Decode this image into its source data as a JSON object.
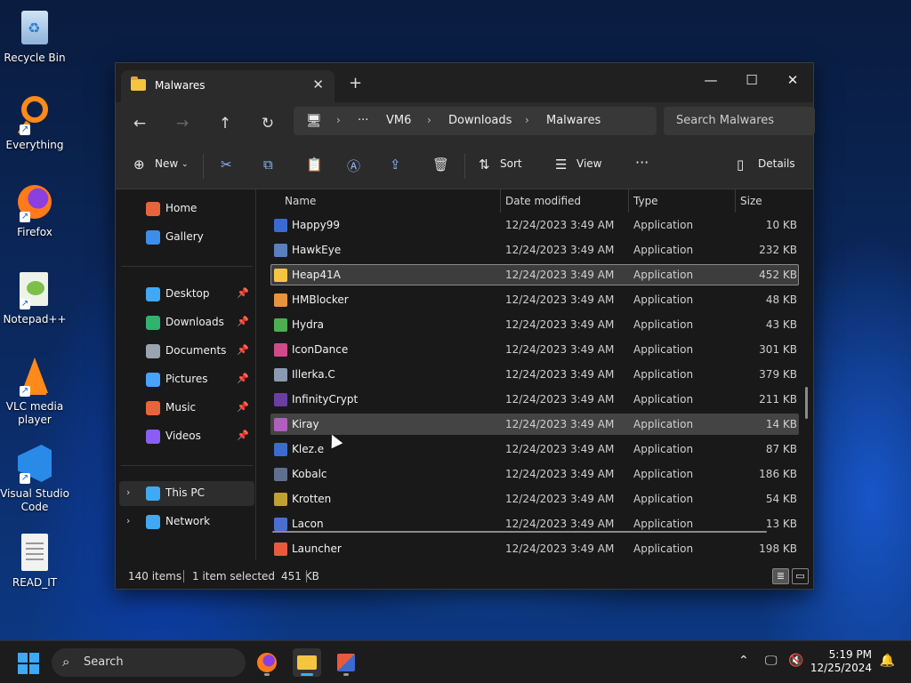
{
  "desktop": {
    "icons": [
      {
        "label": "Recycle Bin",
        "icon": "recycle-bin-icon"
      },
      {
        "label": "Everything",
        "icon": "everything-search-icon"
      },
      {
        "label": "Firefox",
        "icon": "firefox-icon"
      },
      {
        "label": "Notepad++",
        "icon": "notepad-plus-plus-icon"
      },
      {
        "label": "VLC media player",
        "icon": "vlc-icon"
      },
      {
        "label": "Visual Studio Code",
        "icon": "vscode-icon"
      },
      {
        "label": "READ_IT",
        "icon": "text-file-icon"
      }
    ]
  },
  "window": {
    "tab_title": "Malwares",
    "new_tab": "+",
    "close_tab": "✕",
    "controls": {
      "minimize": "—",
      "maximize": "☐",
      "close": "✕"
    }
  },
  "nav": {
    "back": "←",
    "forward": "→",
    "up": "↑",
    "refresh": "↻",
    "breadcrumb": [
      "VM6",
      "Downloads",
      "Malwares"
    ],
    "overflow": "···",
    "search_placeholder": "Search Malwares"
  },
  "toolbar": {
    "new_label": "New",
    "sort_label": "Sort",
    "view_label": "View",
    "more_label": "···",
    "details_label": "Details"
  },
  "sidebar": {
    "top": [
      {
        "label": "Home",
        "icon": "home-icon",
        "color": "#e8643c"
      },
      {
        "label": "Gallery",
        "icon": "gallery-icon",
        "color": "#3b8eea"
      }
    ],
    "pinned": [
      {
        "label": "Desktop",
        "icon": "desktop-folder-icon",
        "color": "#3fa9f5"
      },
      {
        "label": "Downloads",
        "icon": "downloads-folder-icon",
        "color": "#2fb36f"
      },
      {
        "label": "Documents",
        "icon": "documents-folder-icon",
        "color": "#9aa4b0"
      },
      {
        "label": "Pictures",
        "icon": "pictures-folder-icon",
        "color": "#47a3ff"
      },
      {
        "label": "Music",
        "icon": "music-folder-icon",
        "color": "#e8643c"
      },
      {
        "label": "Videos",
        "icon": "videos-folder-icon",
        "color": "#8b5cf6"
      }
    ],
    "bottom": [
      {
        "label": "This PC",
        "icon": "this-pc-icon",
        "color": "#3fa9f5"
      },
      {
        "label": "Network",
        "icon": "network-icon",
        "color": "#3fa9f5"
      }
    ],
    "pin_glyph": "📌"
  },
  "columns": {
    "name": "Name",
    "date": "Date modified",
    "type": "Type",
    "size": "Size"
  },
  "files": [
    {
      "name": "Happy99",
      "date": "12/24/2023 3:49 AM",
      "type": "Application",
      "size": "10 KB",
      "color": "#3a6bd0"
    },
    {
      "name": "HawkEye",
      "date": "12/24/2023 3:49 AM",
      "type": "Application",
      "size": "232 KB",
      "color": "#5a7fbf"
    },
    {
      "name": "Heap41A",
      "date": "12/24/2023 3:49 AM",
      "type": "Application",
      "size": "452 KB",
      "color": "#f5c542"
    },
    {
      "name": "HMBlocker",
      "date": "12/24/2023 3:49 AM",
      "type": "Application",
      "size": "48 KB",
      "color": "#e8943c"
    },
    {
      "name": "Hydra",
      "date": "12/24/2023 3:49 AM",
      "type": "Application",
      "size": "43 KB",
      "color": "#4caf50"
    },
    {
      "name": "IconDance",
      "date": "12/24/2023 3:49 AM",
      "type": "Application",
      "size": "301 KB",
      "color": "#d04a8a"
    },
    {
      "name": "Illerka.C",
      "date": "12/24/2023 3:49 AM",
      "type": "Application",
      "size": "379 KB",
      "color": "#8a9ab0"
    },
    {
      "name": "InfinityCrypt",
      "date": "12/24/2023 3:49 AM",
      "type": "Application",
      "size": "211 KB",
      "color": "#6b3fa0"
    },
    {
      "name": "Kiray",
      "date": "12/24/2023 3:49 AM",
      "type": "Application",
      "size": "14 KB",
      "color": "#b05fc0"
    },
    {
      "name": "Klez.e",
      "date": "12/24/2023 3:49 AM",
      "type": "Application",
      "size": "87 KB",
      "color": "#3a6bd0"
    },
    {
      "name": "Kobalc",
      "date": "12/24/2023 3:49 AM",
      "type": "Application",
      "size": "186 KB",
      "color": "#5f6f8f"
    },
    {
      "name": "Krotten",
      "date": "12/24/2023 3:49 AM",
      "type": "Application",
      "size": "54 KB",
      "color": "#c0a030"
    },
    {
      "name": "Lacon",
      "date": "12/24/2023 3:49 AM",
      "type": "Application",
      "size": "13 KB",
      "color": "#4a6fd0"
    },
    {
      "name": "Launcher",
      "date": "12/24/2023 3:49 AM",
      "type": "Application",
      "size": "198 KB",
      "color": "#e85a3c"
    }
  ],
  "selected_index": 2,
  "hover_index": 8,
  "status": {
    "items": "140 items",
    "selected": "1 item selected",
    "size": "451 KB"
  },
  "taskbar": {
    "search_label": "Search",
    "time": "5:19 PM",
    "date": "12/25/2024"
  }
}
